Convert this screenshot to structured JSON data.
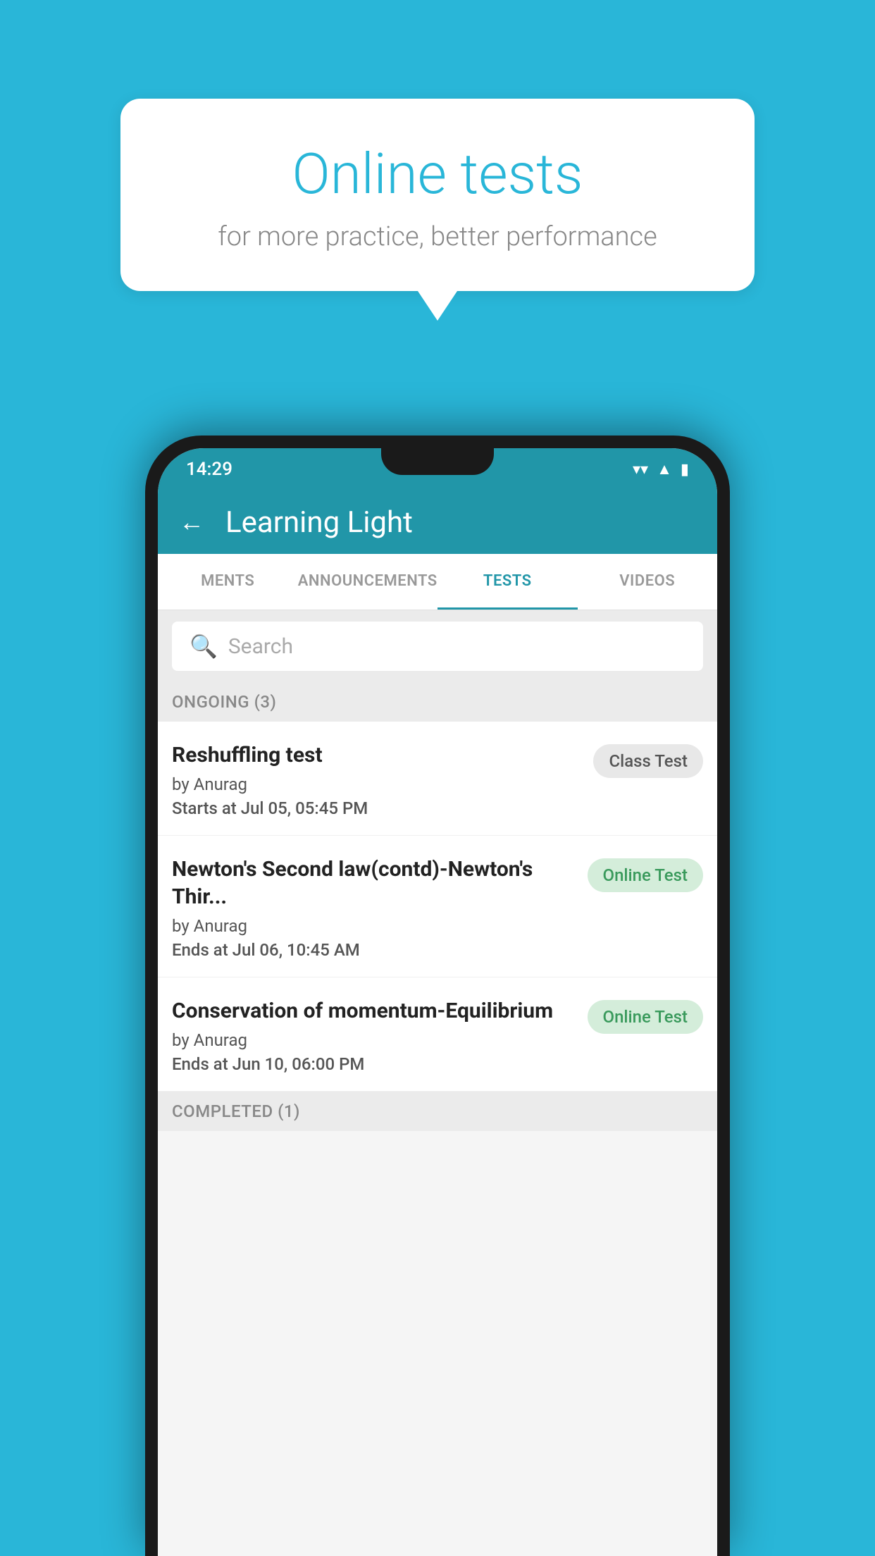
{
  "background_color": "#29b6d8",
  "speech_bubble": {
    "title": "Online tests",
    "subtitle": "for more practice, better performance"
  },
  "phone": {
    "status_bar": {
      "time": "14:29",
      "icons": [
        "wifi",
        "signal",
        "battery"
      ]
    },
    "app_bar": {
      "title": "Learning Light",
      "back_label": "←"
    },
    "tabs": [
      {
        "label": "MENTS",
        "active": false
      },
      {
        "label": "ANNOUNCEMENTS",
        "active": false
      },
      {
        "label": "TESTS",
        "active": true
      },
      {
        "label": "VIDEOS",
        "active": false
      }
    ],
    "search": {
      "placeholder": "Search"
    },
    "sections": [
      {
        "label": "ONGOING (3)",
        "tests": [
          {
            "title": "Reshuffling test",
            "author": "by Anurag",
            "time_label": "Starts at",
            "time_value": "Jul 05, 05:45 PM",
            "badge": "Class Test",
            "badge_type": "class"
          },
          {
            "title": "Newton's Second law(contd)-Newton's Thir...",
            "author": "by Anurag",
            "time_label": "Ends at",
            "time_value": "Jul 06, 10:45 AM",
            "badge": "Online Test",
            "badge_type": "online"
          },
          {
            "title": "Conservation of momentum-Equilibrium",
            "author": "by Anurag",
            "time_label": "Ends at",
            "time_value": "Jun 10, 06:00 PM",
            "badge": "Online Test",
            "badge_type": "online"
          }
        ]
      }
    ],
    "completed_label": "COMPLETED (1)"
  }
}
